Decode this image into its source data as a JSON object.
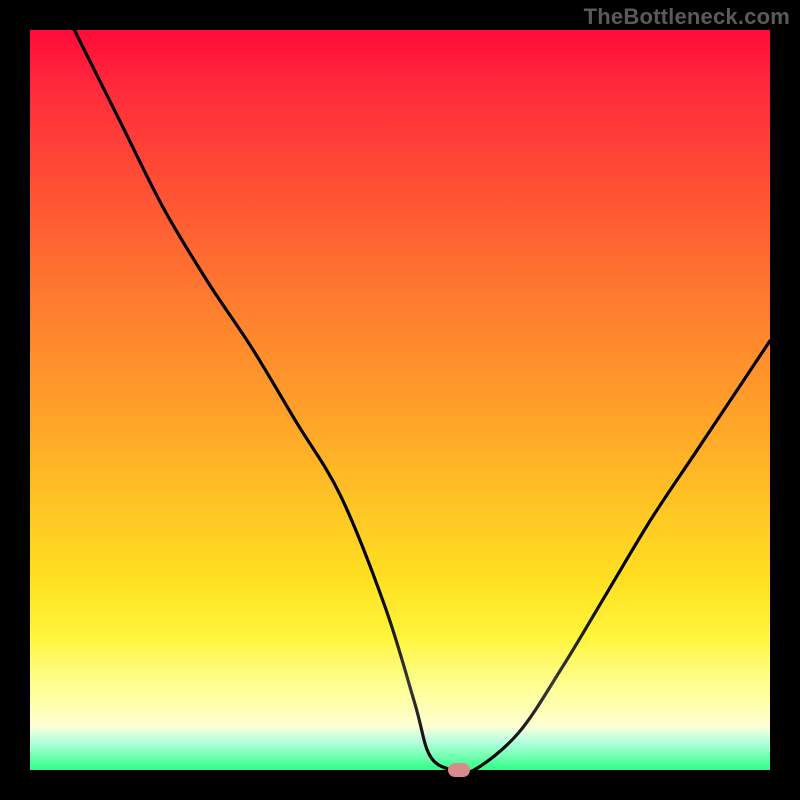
{
  "watermark": "TheBottleneck.com",
  "chart_data": {
    "type": "line",
    "title": "",
    "xlabel": "",
    "ylabel": "",
    "xlim": [
      0,
      100
    ],
    "ylim": [
      0,
      100
    ],
    "grid": false,
    "legend": false,
    "series": [
      {
        "name": "curve",
        "x": [
          6,
          12,
          18,
          24,
          30,
          36,
          42,
          48,
          52,
          54,
          57,
          60,
          66,
          72,
          78,
          84,
          90,
          96,
          100
        ],
        "y": [
          100,
          88,
          76,
          66,
          57,
          47,
          37,
          22,
          9,
          2,
          0,
          0,
          5,
          14,
          24,
          34,
          43,
          52,
          58
        ]
      }
    ],
    "marker": {
      "x": 58,
      "y": 0,
      "shape": "rounded-rect",
      "color": "#d98a8f"
    },
    "background_gradient": [
      "#ff0b3a",
      "#ff7a2f",
      "#ffcf23",
      "#ffffcf",
      "#2fff85"
    ]
  }
}
